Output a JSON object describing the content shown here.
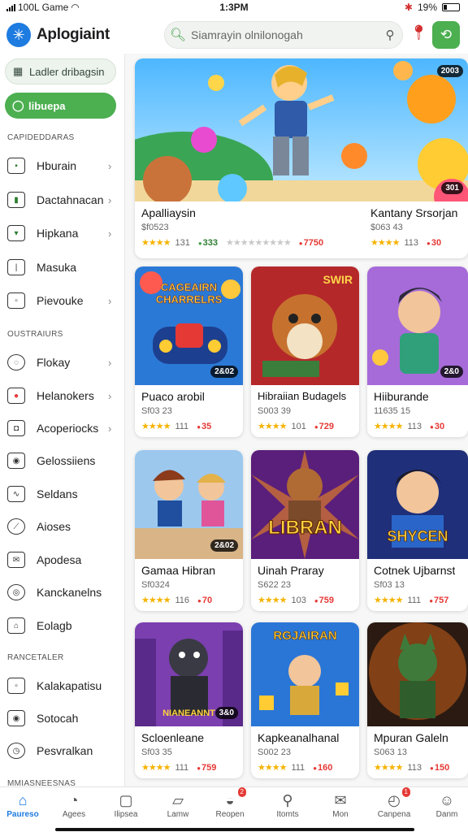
{
  "status": {
    "carrier": "100L Game",
    "time": "1:3PM",
    "battery": "19%"
  },
  "header": {
    "app_title": "Aplogiaint",
    "search_placeholder": "Siamrayin olnilonogah"
  },
  "sidebar": {
    "top_pill": "Ladler dribagsin",
    "active_pill": "libuepa",
    "sections": [
      {
        "title": "CAPIDEDDARAS",
        "items": [
          "Hburain",
          "Dactahnacan",
          "Hipkana",
          "Masuka",
          "Pievouke"
        ]
      },
      {
        "title": "OUSTRAIURS",
        "items": [
          "Flokay",
          "Helanokers",
          "Acoperiocks",
          "Gelossiiens",
          "Seldans",
          "Aioses",
          "Apodesa",
          "Kanckanelns",
          "Eolagb"
        ]
      },
      {
        "title": "RANCETALER",
        "items": [
          "Kalakapatisu",
          "Sotocah",
          "Pesvralkan"
        ]
      },
      {
        "title": "MMIASNEESNAS",
        "items": []
      }
    ]
  },
  "featured": [
    {
      "title": "Apalliaysin",
      "price": "$f0523",
      "rating_count": "131",
      "tag": "333",
      "tag2": "7750",
      "badge": "2003",
      "badge2": "301"
    },
    {
      "title": "Kantany Srsorjan",
      "price": "$063 43",
      "rating_count": "113",
      "tag": "30"
    }
  ],
  "games": [
    {
      "title": "Puaco arobil",
      "price": "Sf03 23",
      "count": "111",
      "tag": "35",
      "badge": "2&02",
      "art_text": "CAGEAIRN CHARRELRS"
    },
    {
      "title": "Hibraiian Budagels",
      "price": "S003 39",
      "count": "101",
      "tag": "729",
      "badge": "",
      "art_text": "SWIR"
    },
    {
      "title": "Hiiburande",
      "price": "11635 15",
      "count": "113",
      "tag": "30",
      "badge": "2&0",
      "art_text": ""
    },
    {
      "title": "Gamaa Hibran",
      "price": "Sf0324",
      "count": "116",
      "tag": "70",
      "badge": "2&02",
      "art_text": ""
    },
    {
      "title": "Uinah Praray",
      "price": "S622 23",
      "count": "103",
      "tag": "759",
      "badge": "",
      "art_text": "LIBRAN"
    },
    {
      "title": "Cotnek Ujbarnst",
      "price": "Sf03 13",
      "count": "111",
      "tag": "757",
      "badge": "",
      "art_text": "SHYCEN"
    },
    {
      "title": "Scloenleane",
      "price": "Sf03 35",
      "count": "111",
      "tag": "759",
      "badge": "3&0",
      "art_text": "NIANEANNT"
    },
    {
      "title": "Kapkeanalhanal",
      "price": "S002 23",
      "count": "111",
      "tag": "160",
      "badge": "",
      "art_text": "RGJAIRAN"
    },
    {
      "title": "Mpuran Galeln",
      "price": "S063 13",
      "count": "113",
      "tag": "150",
      "badge": "",
      "art_text": ""
    }
  ],
  "nav": [
    {
      "label": "Paureso",
      "icon": "home-icon"
    },
    {
      "label": "Agees",
      "icon": "compass-icon"
    },
    {
      "label": "Ilipsea",
      "icon": "square-icon"
    },
    {
      "label": "Lamw",
      "icon": "bookmark-icon"
    },
    {
      "label": "Reopen",
      "icon": "controller-icon",
      "badge": "2"
    },
    {
      "label": "Itomts",
      "icon": "search-icon"
    },
    {
      "label": "Mon",
      "icon": "mail-icon"
    },
    {
      "label": "Canpena",
      "icon": "gauge-icon",
      "badge": "1"
    },
    {
      "label": "Danm",
      "icon": "person-icon"
    }
  ],
  "colors": {
    "accent_green": "#4caf50",
    "accent_blue": "#1e7be0",
    "alert_red": "#e53935",
    "star": "#f5b301"
  }
}
